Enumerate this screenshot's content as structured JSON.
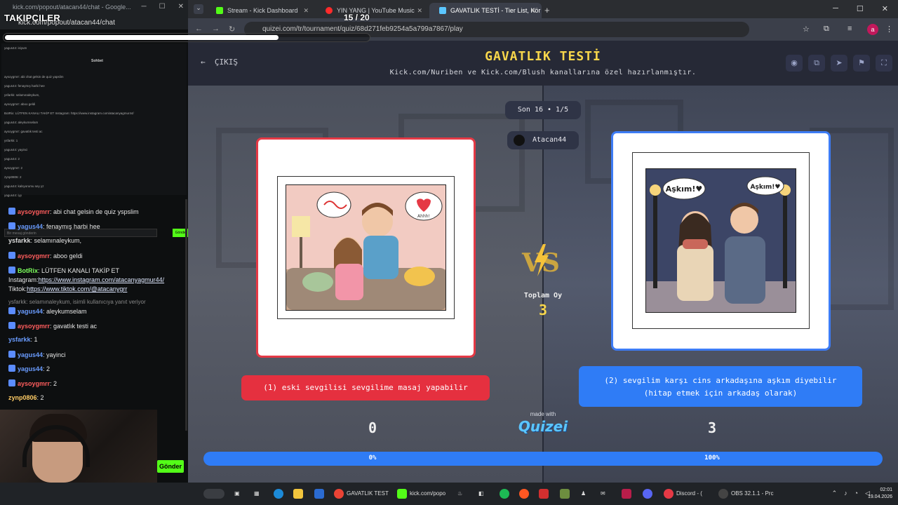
{
  "overlay": {
    "title": "TAKIPÇILER",
    "count": "15 / 20",
    "progress": 0.75
  },
  "chat_window": {
    "title": "kick.com/popout/atacan44/chat - Google...",
    "url": "kick.com/popout/atacan44/chat",
    "mini_header": "Sohbet",
    "mini_lines": [
      "yagus44: isiyum",
      "aysoygmrr: abi chat gelsin de quiz yapslim",
      "yagus44: fenaymış harbi hee",
      "ysfarkk: selamınaleykum,",
      "aysoygmrr: aboo geldi",
      "BotRix: LÜTFEN KANALI TAKİP ET Instagram: https://www.instagram.com/atacanyagmur44/",
      "yagus44: aleykumselam",
      "aysoygmrr: gavatlık testi ac",
      "ysfarkk: 1",
      "yagus44: yayinci",
      "yagus44: 2",
      "aysoygmrr: 2",
      "zynp0806: 2",
      "yagus44: kalsyorumu sey yz",
      "yagus44: iyy"
    ],
    "mini_input_placeholder": "Bir mesaj gönderin",
    "mini_send": "Gönder",
    "send_label": "Gönder",
    "messages": [
      {
        "user": "aysoygmrr",
        "text": ": abi chat gelsin de quiz yspslim",
        "color": "red",
        "badge": true
      },
      {
        "user": "yagus44",
        "text": ": fenaymış harbi hee",
        "color": "blue",
        "badge": true
      },
      {
        "user": "ysfarkk",
        "text": ": selamınaleykum,",
        "color": "white",
        "badge": false
      },
      {
        "user": "aysoygmrr",
        "text": ": aboo geldi",
        "color": "red",
        "badge": true
      },
      {
        "user": "BotRix",
        "text": ": LÜTFEN KANALI TAKİP ET",
        "color": "green",
        "badge": true
      },
      {
        "user": "",
        "text": "Instagram:",
        "link": "https://www.instagram.com/atacanyagmur44/",
        "color": "white",
        "badge": false
      },
      {
        "user": "",
        "text": "Tiktok:",
        "link": "https://www.tiktok.com/@atacanygrr",
        "color": "white",
        "badge": false
      },
      {
        "user": "",
        "text": "ysfarkk: selamınaleykum, isimli kullanıcıya yanıt veriyor",
        "color": "reply",
        "badge": false
      },
      {
        "user": "yagus44",
        "text": ": aleykumselam",
        "color": "blue",
        "badge": true
      },
      {
        "user": "aysoygmrr",
        "text": ": gavatlık testi ac",
        "color": "red",
        "badge": true
      },
      {
        "user": "ysfarkk",
        "text": ": 1",
        "color": "blue",
        "badge": false
      },
      {
        "user": "yagus44",
        "text": ": yayinci",
        "color": "blue",
        "badge": true
      },
      {
        "user": "yagus44",
        "text": ": 2",
        "color": "blue",
        "badge": true
      },
      {
        "user": "aysoygmrr",
        "text": ": 2",
        "color": "red",
        "badge": true
      },
      {
        "user": "zynp0806",
        "text": ": 2",
        "color": "yellow",
        "badge": false
      }
    ]
  },
  "browser": {
    "tabs": [
      {
        "label": "Stream - Kick Dashboard",
        "fav_color": "#53fc18",
        "active": false
      },
      {
        "label": "YIN YANG | YouTube Music",
        "fav_color": "#ff2b2b",
        "active": false
      },
      {
        "label": "GAVATLIK TESTİ - Tier List, Kör",
        "fav_color": "#5bc6ff",
        "active": true
      }
    ],
    "url": "quizei.com/tr/tournament/quiz/68d271feb9254a5a799a7867/play",
    "profile_initial": "a"
  },
  "page": {
    "exit_label": "ÇIKIŞ",
    "title": "GAVATLIK TESTİ",
    "subtitle": "Kick.com/Nuriben ve Kick.com/Blush kanallarına özel hazırlanmıştır.",
    "round": "Son 16 • 1/5",
    "username": "Atacan44",
    "vs": "VS",
    "total_label": "Toplam Oy",
    "total_value": "3",
    "option_left": "(1) eski sevgilisi sevgilime masaj yapabilir",
    "option_right_line1": "(2) sevgilim karşı cins arkadaşına aşkım diyebilir",
    "option_right_line2": "(hitap etmek için arkadaş olarak)",
    "made_with": "made with",
    "brand": "Quizei",
    "left_votes": "0",
    "right_votes": "3",
    "left_pct": "0%",
    "right_pct": "100%",
    "left_share": 0,
    "right_bubble_left": "Aşkım!♥",
    "right_bubble_right": "Aşkım!♥",
    "left_bubble_text": "Ahhh!",
    "colors": {
      "accent_yellow": "#f7d64b",
      "red": "#e5303f",
      "blue": "#2f7cf6"
    }
  },
  "taskbar": {
    "apps": [
      {
        "label": "GAVATLIK TEST",
        "color": "#ea4335"
      },
      {
        "label": "kick.com/popo",
        "color": "#53fc18"
      },
      {
        "label": "Discord - (",
        "color": "#5865f2"
      },
      {
        "label": "OBS 32.1.1 - Prc",
        "color": "#444"
      }
    ],
    "time": "02:01",
    "date": "19.04.2026"
  }
}
